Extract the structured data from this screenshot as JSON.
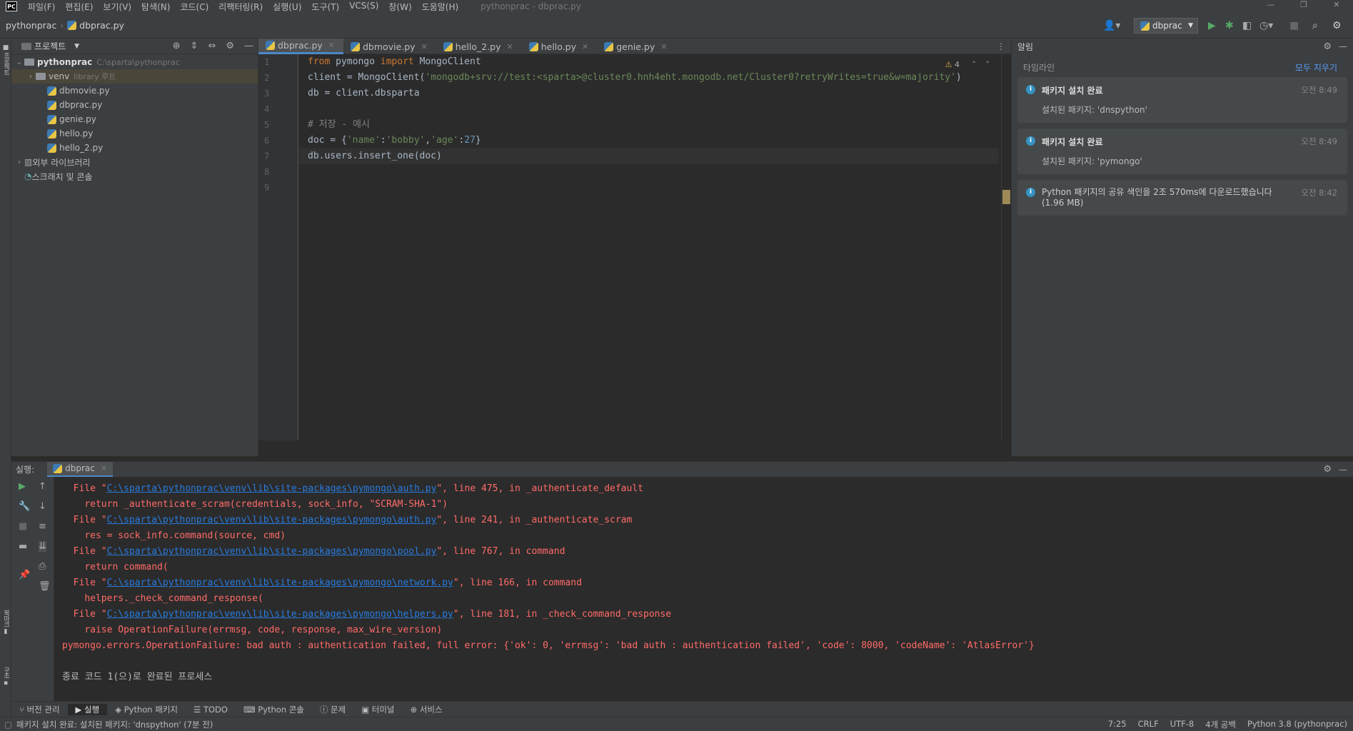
{
  "menu": {
    "items": [
      "파일(F)",
      "편집(E)",
      "보기(V)",
      "탐색(N)",
      "코드(C)",
      "리팩터링(R)",
      "실행(U)",
      "도구(T)",
      "VCS(S)",
      "창(W)",
      "도움말(H)"
    ],
    "window_title": "pythonprac - dbprac.py"
  },
  "nav": {
    "project": "pythonprac",
    "file": "dbprac.py",
    "run_config": "dbprac"
  },
  "project_panel": {
    "title": "프로젝트",
    "tree": [
      {
        "name": "pythonprac",
        "extra": "C:\\sparta\\pythonprac",
        "type": "folder",
        "indent": 0,
        "arrow": "v"
      },
      {
        "name": "venv",
        "extra": "library 루트",
        "type": "folder",
        "indent": 1,
        "arrow": ">",
        "selected": true
      },
      {
        "name": "dbmovie.py",
        "type": "py",
        "indent": 2
      },
      {
        "name": "dbprac.py",
        "type": "py",
        "indent": 2
      },
      {
        "name": "genie.py",
        "type": "py",
        "indent": 2
      },
      {
        "name": "hello.py",
        "type": "py",
        "indent": 2
      },
      {
        "name": "hello_2.py",
        "type": "py",
        "indent": 2
      },
      {
        "name": "외부 라이브러리",
        "type": "lib",
        "indent": 0,
        "arrow": ">"
      },
      {
        "name": "스크래치 및 콘솔",
        "type": "scratch",
        "indent": 0
      }
    ]
  },
  "tabs": [
    "dbprac.py",
    "dbmovie.py",
    "hello_2.py",
    "hello.py",
    "genie.py"
  ],
  "editor": {
    "warnings": "4",
    "current_line": 7,
    "lines": [
      [
        [
          "kw",
          "from "
        ],
        [
          "",
          "pymongo "
        ],
        [
          "kw",
          "import "
        ],
        [
          "",
          "MongoClient"
        ]
      ],
      [
        [
          "",
          "client = MongoClient("
        ],
        [
          "st",
          "'mongodb+srv://test:<sparta>@cluster0.hnh4eht.mongodb.net/Cluster0?retryWrites=true&w=majority'"
        ],
        [
          "",
          ")"
        ]
      ],
      [
        [
          "",
          "db = client.dbsparta"
        ]
      ],
      [],
      [
        [
          "cm",
          "# 저장 - 예시"
        ]
      ],
      [
        [
          "",
          "doc = {"
        ],
        [
          "st",
          "'name'"
        ],
        [
          "",
          ":"
        ],
        [
          "st",
          "'bobby'"
        ],
        [
          "",
          ","
        ],
        [
          "st",
          "'age'"
        ],
        [
          "",
          ":"
        ],
        [
          "nm",
          "27"
        ],
        [
          "",
          "}"
        ]
      ],
      [
        [
          "",
          "db.users.insert_one(doc)"
        ]
      ],
      [],
      []
    ]
  },
  "notifications": {
    "title": "알림",
    "timeline": "타임라인",
    "clear_all": "모두 지우기",
    "items": [
      {
        "title": "패키지 설치 완료",
        "time": "오전 8:49",
        "body": "설치된 패키지: 'dnspython'"
      },
      {
        "title": "패키지 설치 완료",
        "time": "오전 8:49",
        "body": "설치된 패키지: 'pymongo'"
      },
      {
        "title": "Python 패키지의 공유 색인을 2조 570ms에 다운로드했습니다(1.96 MB)",
        "time": "오전 8:42",
        "body": ""
      }
    ]
  },
  "run": {
    "label": "실행:",
    "tab": "dbprac",
    "output": [
      {
        "indent": "  ",
        "pre": "File \"",
        "link": "C:\\sparta\\pythonprac\\venv\\lib\\site-packages\\pymongo\\auth.py",
        "post": "\", line 475, in _authenticate_default"
      },
      {
        "indent": "    ",
        "pre": "return _authenticate_scram(credentials, sock_info, \"SCRAM-SHA-1\")",
        "link": "",
        "post": ""
      },
      {
        "indent": "  ",
        "pre": "File \"",
        "link": "C:\\sparta\\pythonprac\\venv\\lib\\site-packages\\pymongo\\auth.py",
        "post": "\", line 241, in _authenticate_scram"
      },
      {
        "indent": "    ",
        "pre": "res = sock_info.command(source, cmd)",
        "link": "",
        "post": ""
      },
      {
        "indent": "  ",
        "pre": "File \"",
        "link": "C:\\sparta\\pythonprac\\venv\\lib\\site-packages\\pymongo\\pool.py",
        "post": "\", line 767, in command"
      },
      {
        "indent": "    ",
        "pre": "return command(",
        "link": "",
        "post": ""
      },
      {
        "indent": "  ",
        "pre": "File \"",
        "link": "C:\\sparta\\pythonprac\\venv\\lib\\site-packages\\pymongo\\network.py",
        "post": "\", line 166, in command"
      },
      {
        "indent": "    ",
        "pre": "helpers._check_command_response(",
        "link": "",
        "post": ""
      },
      {
        "indent": "  ",
        "pre": "File \"",
        "link": "C:\\sparta\\pythonprac\\venv\\lib\\site-packages\\pymongo\\helpers.py",
        "post": "\", line 181, in _check_command_response"
      },
      {
        "indent": "    ",
        "pre": "raise OperationFailure(errmsg, code, response, max_wire_version)",
        "link": "",
        "post": ""
      },
      {
        "indent": "",
        "pre": "pymongo.errors.OperationFailure: bad auth : authentication failed, full error: {'ok': 0, 'errmsg': 'bad auth : authentication failed', 'code': 8000, 'codeName': 'AtlasError'}",
        "link": "",
        "post": ""
      },
      {
        "indent": "",
        "pre": "",
        "link": "",
        "post": ""
      },
      {
        "indent": "",
        "pre": "종료 코드 1(으)로 완료된 프로세스",
        "link": "",
        "post": "",
        "ok": true
      }
    ]
  },
  "bottom_tabs": [
    "버전 관리",
    "실행",
    "Python 패키지",
    "TODO",
    "Python 콘솔",
    "문제",
    "터미널",
    "서비스"
  ],
  "status": {
    "message": "패키지 설치 완료: 설치된 패키지: 'dnspython' (7분 전)",
    "pos": "7:25",
    "eol": "CRLF",
    "enc": "UTF-8",
    "indent": "4개 공백",
    "interp": "Python 3.8 (pythonprac)"
  }
}
